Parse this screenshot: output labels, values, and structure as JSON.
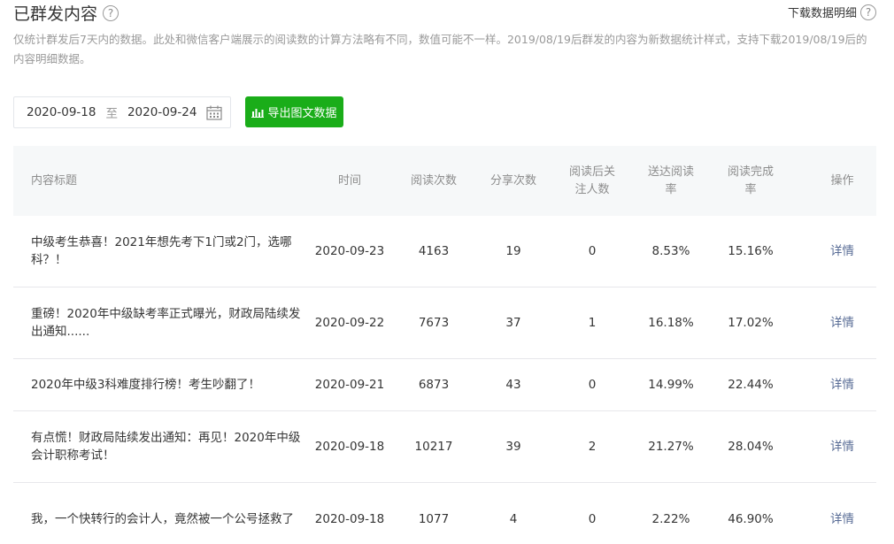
{
  "header": {
    "title": "已群发内容",
    "help": "?",
    "download_label": "下载数据明细",
    "download_help": "?"
  },
  "description": "仅统计群发后7天内的数据。此处和微信客户端展示的阅读数的计算方法略有不同，数值可能不一样。2019/08/19后群发的内容为新数据统计样式，支持下载2019/08/19后的内容明细数据。",
  "filter": {
    "start_date": "2020-09-18",
    "separator": "至",
    "end_date": "2020-09-24",
    "export_label": "导出图文数据"
  },
  "table": {
    "columns": {
      "title": "内容标题",
      "time": "时间",
      "reads": "阅读次数",
      "shares": "分享次数",
      "follow_line1": "阅读后关",
      "follow_line2": "注人数",
      "delivery_line1": "送达阅读",
      "delivery_line2": "率",
      "complete_line1": "阅读完成",
      "complete_line2": "率",
      "op": "操作"
    },
    "rows": [
      {
        "title": "中级考生恭喜！2021年想先考下1门或2门，选哪科？！",
        "time": "2020-09-23",
        "reads": "4163",
        "shares": "19",
        "follow": "0",
        "delivery": "8.53%",
        "complete": "15.16%",
        "op": "详情"
      },
      {
        "title": "重磅！2020年中级缺考率正式曝光，财政局陆续发出通知......",
        "time": "2020-09-22",
        "reads": "7673",
        "shares": "37",
        "follow": "1",
        "delivery": "16.18%",
        "complete": "17.02%",
        "op": "详情"
      },
      {
        "title": "2020年中级3科难度排行榜！考生吵翻了！",
        "time": "2020-09-21",
        "reads": "6873",
        "shares": "43",
        "follow": "0",
        "delivery": "14.99%",
        "complete": "22.44%",
        "op": "详情"
      },
      {
        "title": "有点慌！财政局陆续发出通知：再见！2020年中级会计职称考试！",
        "time": "2020-09-18",
        "reads": "10217",
        "shares": "39",
        "follow": "2",
        "delivery": "21.27%",
        "complete": "28.04%",
        "op": "详情"
      },
      {
        "title": "我，一个快转行的会计人，竟然被一个公号拯救了",
        "time": "2020-09-18",
        "reads": "1077",
        "shares": "4",
        "follow": "0",
        "delivery": "2.22%",
        "complete": "46.90%",
        "op": "详情"
      }
    ]
  },
  "colors": {
    "accent_green": "#1aad19",
    "link_blue": "#576b95",
    "header_bg": "#f6f8f9",
    "muted_text": "#9a9a9a"
  },
  "icons": [
    "help-icon",
    "calendar-icon",
    "bar-chart-icon"
  ]
}
